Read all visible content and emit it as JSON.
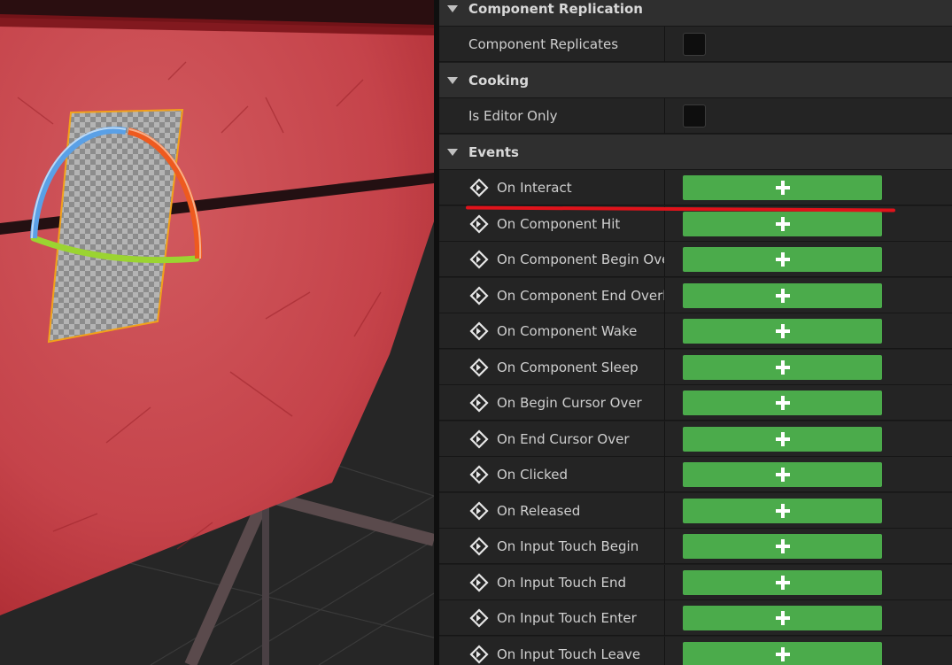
{
  "viewport": {
    "wall_color": "#c8474c",
    "floor_color": "#262626"
  },
  "details": {
    "categories": {
      "component_replication": "Component Replication",
      "cooking": "Cooking",
      "events": "Events"
    },
    "properties": {
      "component_replicates": "Component Replicates",
      "is_editor_only": "Is Editor Only"
    },
    "events": [
      "On Interact",
      "On Component Hit",
      "On Component Begin Overl",
      "On Component End Overlap",
      "On Component Wake",
      "On Component Sleep",
      "On Begin Cursor Over",
      "On End Cursor Over",
      "On Clicked",
      "On Released",
      "On Input Touch Begin",
      "On Input Touch End",
      "On Input Touch Enter",
      "On Input Touch Leave"
    ],
    "add_button_color": "#4bab4b",
    "highlight_color": "#e0131b",
    "icons": {
      "category_toggle": "triangle-down-icon",
      "event": "event-diamond-icon",
      "add": "plus-icon"
    }
  }
}
